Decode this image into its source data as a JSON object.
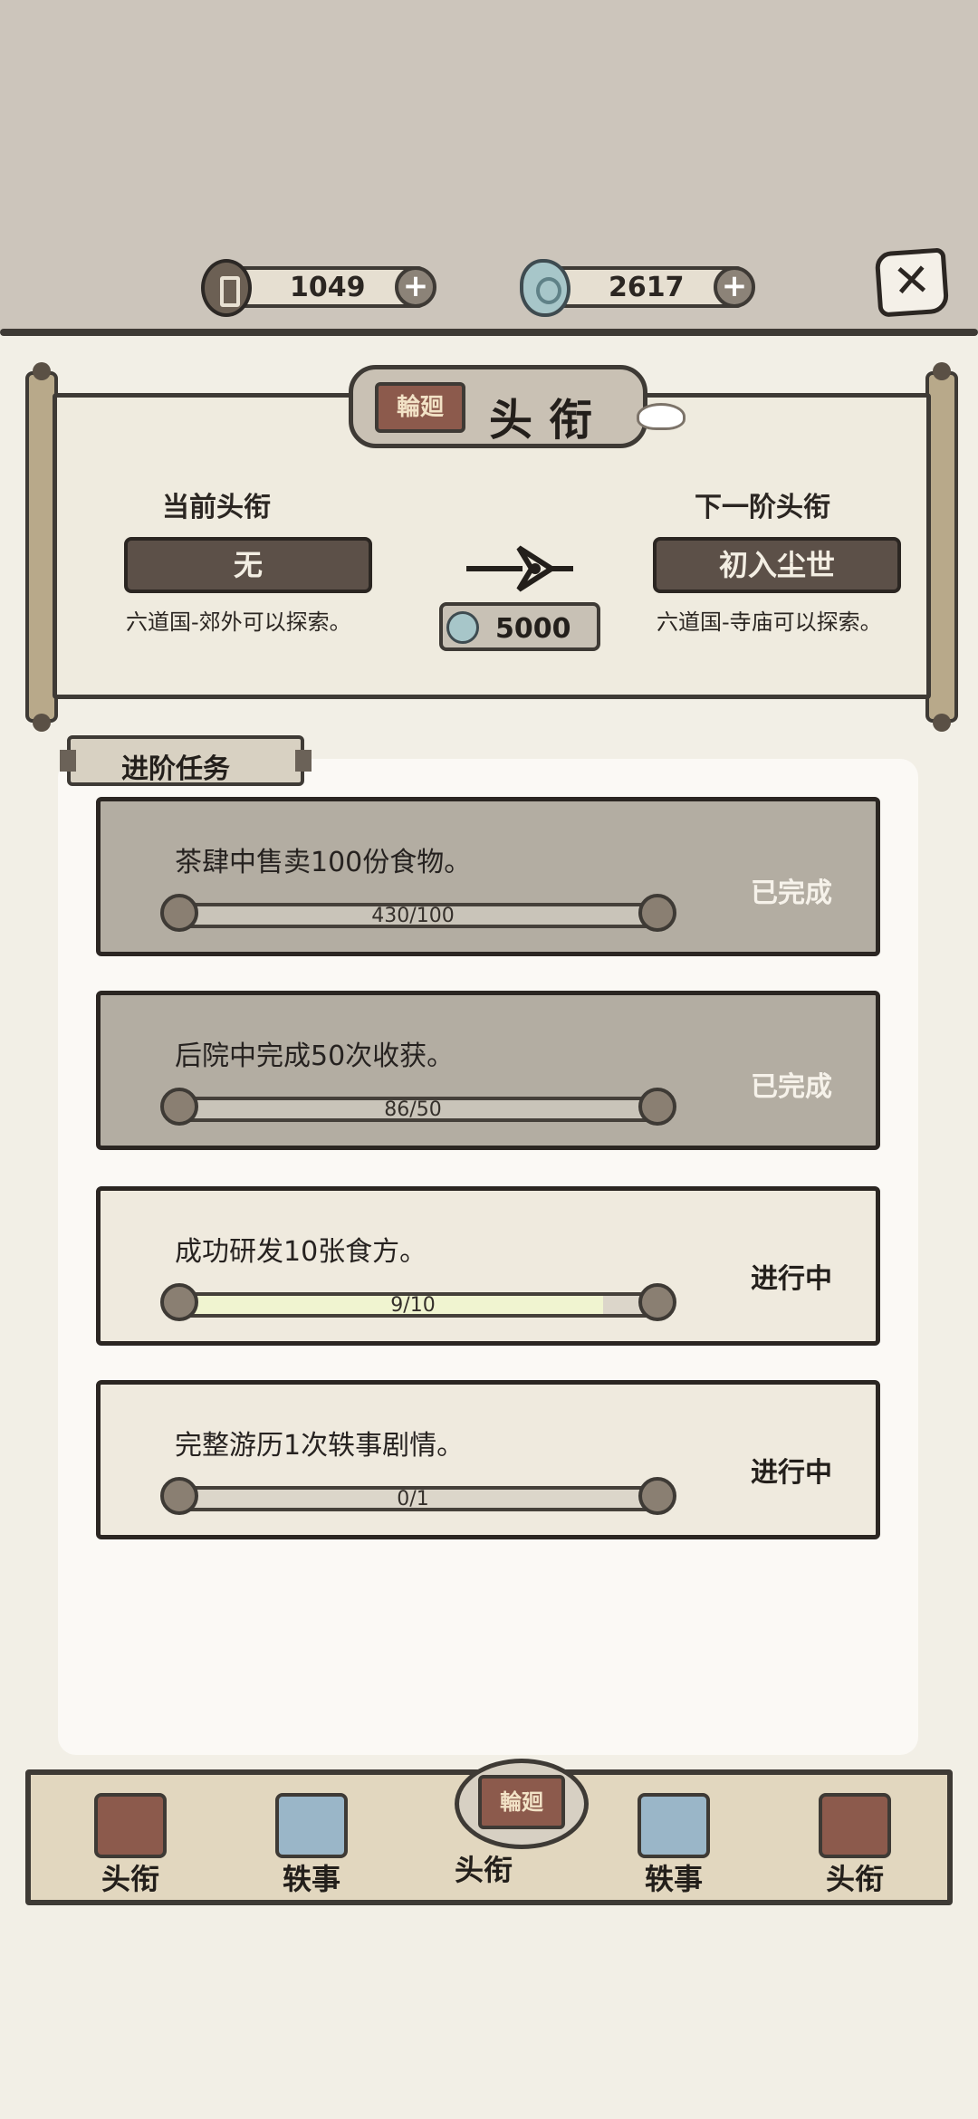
{
  "header": {
    "coins": "1049",
    "jade": "2617",
    "plus_symbol": "+",
    "close_symbol": "✕"
  },
  "title_panel": {
    "seal_text": "輪廻",
    "title": "头衔",
    "current_label": "当前头衔",
    "current_value": "无",
    "current_unlock": "六道国-郊外可以探索。",
    "next_label": "下一阶头衔",
    "next_value": "初入尘世",
    "next_unlock": "六道国-寺庙可以探索。",
    "cost": "5000"
  },
  "tasks": {
    "header": "进阶任务",
    "items": [
      {
        "desc": "茶肆中售卖100份食物。",
        "progress_text": "430/100",
        "progress": 1.0,
        "status": "已完成"
      },
      {
        "desc": "后院中完成50次收获。",
        "progress_text": "86/50",
        "progress": 1.0,
        "status": "已完成"
      },
      {
        "desc": "成功研发10张食方。",
        "progress_text": "9/10",
        "progress": 0.9,
        "status": "进行中"
      },
      {
        "desc": "完整游历1次轶事剧情。",
        "progress_text": "0/1",
        "progress": 0.0,
        "status": "进行中"
      }
    ]
  },
  "bottom_nav": {
    "items": [
      {
        "label": "头衔",
        "icon": "seal-icon"
      },
      {
        "label": "轶事",
        "icon": "scroll-icon"
      },
      {
        "label": "头衔",
        "icon": "seal-icon",
        "active": true,
        "seal_text": "輪廻"
      },
      {
        "label": "轶事",
        "icon": "scroll-icon"
      },
      {
        "label": "头衔",
        "icon": "seal-icon"
      }
    ]
  }
}
